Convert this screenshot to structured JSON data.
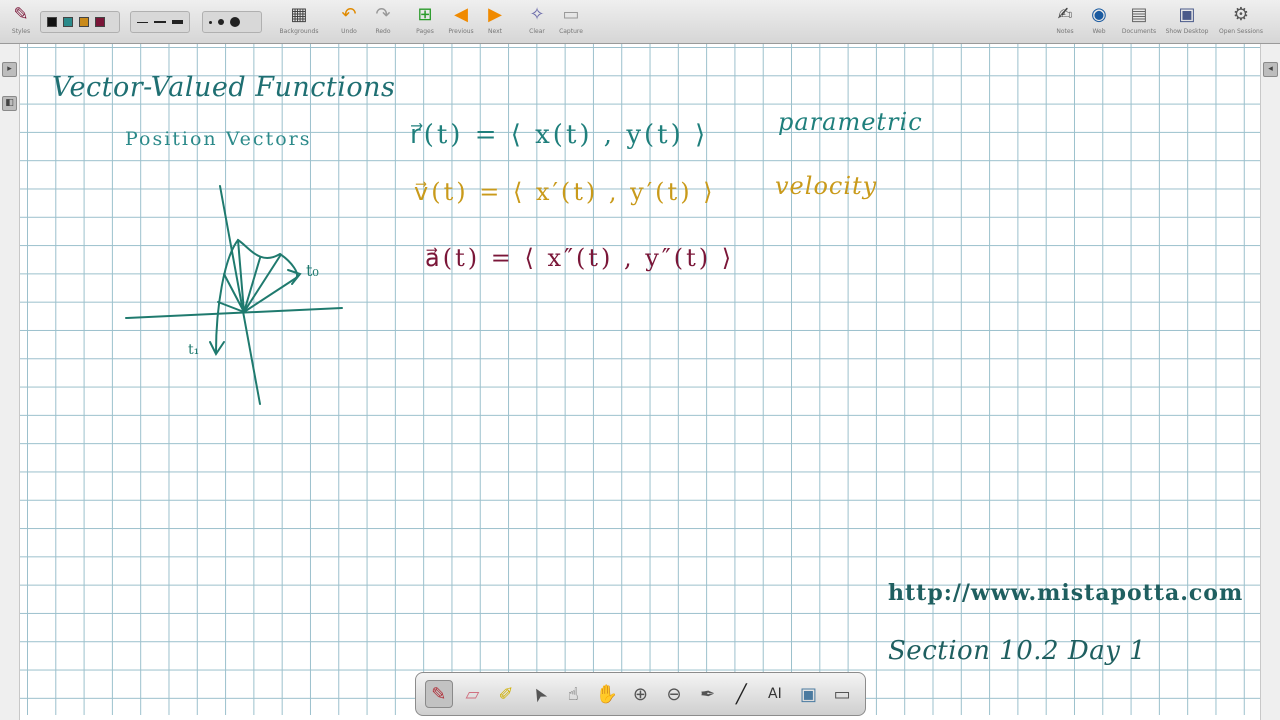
{
  "toolbar": {
    "colors": [
      "#111111",
      "#2a8a8a",
      "#c98a1a",
      "#7a1638"
    ],
    "buttons": [
      {
        "name": "styles",
        "label": "Styles",
        "icon": "pencil-icon"
      },
      {
        "name": "backgrounds",
        "label": "Backgrounds",
        "icon": "backgrounds-icon"
      },
      {
        "name": "undo",
        "label": "Undo",
        "icon": "undo-icon"
      },
      {
        "name": "redo",
        "label": "Redo",
        "icon": "redo-icon"
      },
      {
        "name": "pages",
        "label": "Pages",
        "icon": "pages-icon"
      },
      {
        "name": "previous",
        "label": "Previous",
        "icon": "arrow-left-icon"
      },
      {
        "name": "next",
        "label": "Next",
        "icon": "arrow-right-icon"
      },
      {
        "name": "clear",
        "label": "Clear",
        "icon": "clear-icon"
      },
      {
        "name": "capture",
        "label": "Capture",
        "icon": "capture-icon"
      },
      {
        "name": "notes",
        "label": "Notes",
        "icon": "notes-icon"
      },
      {
        "name": "web",
        "label": "Web",
        "icon": "globe-icon"
      },
      {
        "name": "documents",
        "label": "Documents",
        "icon": "folder-icon"
      },
      {
        "name": "show-desktop",
        "label": "Show Desktop",
        "icon": "desktop-icon"
      },
      {
        "name": "open-sessions",
        "label": "Open Sessions",
        "icon": "gear-icon"
      }
    ]
  },
  "notes": {
    "title": "Vector-Valued Functions",
    "subtitle": "Position Vectors",
    "eq_position": "r⃗(t) = ⟨ x(t) , y(t) ⟩",
    "label_position": "parametric",
    "eq_velocity": "v⃗(t) = ⟨ x′(t) , y′(t) ⟩",
    "label_velocity": "velocity",
    "eq_acceleration": "a⃗(t) = ⟨ x″(t) , y″(t) ⟩",
    "sketch_label_top": "t₀",
    "sketch_label_bottom": "t₁",
    "url": "http://www.mistapotta.com",
    "section": "Section 10.2 Day 1"
  },
  "bottom_tools": [
    {
      "name": "pen",
      "icon": "pen-icon",
      "glyph": "✎",
      "active": true
    },
    {
      "name": "eraser",
      "icon": "eraser-icon",
      "glyph": "▱"
    },
    {
      "name": "highlighter",
      "icon": "highlighter-icon",
      "glyph": "✐"
    },
    {
      "name": "select",
      "icon": "cursor-icon",
      "glyph": "➤"
    },
    {
      "name": "hand-touch",
      "icon": "hand-touch-icon",
      "glyph": "☝"
    },
    {
      "name": "pan",
      "icon": "hand-icon",
      "glyph": "✋"
    },
    {
      "name": "zoom-in",
      "icon": "zoom-in-icon",
      "glyph": "⊕"
    },
    {
      "name": "zoom-out",
      "icon": "zoom-out-icon",
      "glyph": "⊖"
    },
    {
      "name": "magic-pen",
      "icon": "magic-pen-icon",
      "glyph": "✒"
    },
    {
      "name": "line",
      "icon": "line-icon",
      "glyph": "╱"
    },
    {
      "name": "text",
      "icon": "text-icon",
      "glyph": "AI"
    },
    {
      "name": "fill",
      "icon": "fill-icon",
      "glyph": "▣"
    },
    {
      "name": "keyboard",
      "icon": "keyboard-icon",
      "glyph": "▭"
    }
  ]
}
